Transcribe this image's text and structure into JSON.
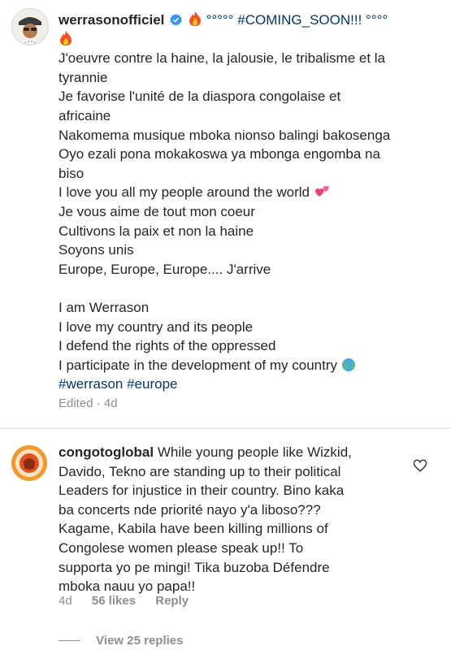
{
  "post": {
    "username": "werrasonofficiel",
    "head": "°°°°° #COMING_SOON!!! °°°°",
    "lines": [
      "J'oeuvre contre la haine, la jalousie, le tribalisme et la",
      "tyrannie",
      "Je favorise l'unité de la diaspora congolaise et",
      "africaine",
      "Nakomema musique mboka nionso balingi bakosenga",
      "Oyo ezali pona mokakoswa ya mbonga engomba na",
      "biso",
      "I love you all my people around the world",
      "Je vous aime de tout mon coeur",
      "Cultivons la paix et non la haine",
      "Soyons unis",
      "Europe, Europe, Europe.... J'arrive",
      "I am Werrason",
      "I love my country and its people",
      "I defend the rights of the oppressed",
      "I participate in the development of my country"
    ],
    "hashtags": "#werrason #europe",
    "edited": "Edited · 4d",
    "icons": [
      "verified-badge",
      "fire-emoji",
      "two-hearts-emoji",
      "globe-emoji"
    ]
  },
  "comment": {
    "username": "congotoglobal",
    "lines": [
      "While young people like Wizkid,",
      "Davido, Tekno are standing up to their political",
      "Leaders for injustice in their country. Bino kaka",
      "ba concerts nde priorité nayo y'a liboso???",
      "Kagame, Kabila have been killing millions of",
      "Congolese women please speak up!! To",
      "supporta yo pe mingi! Tika buzoba Défendre",
      "mboka nauu yo papa!!"
    ],
    "age": "4d",
    "likes": "56 likes",
    "reply": "Reply",
    "view_replies": "View 25 replies"
  },
  "colors": {
    "text": "#262626",
    "hashtag": "#00376b",
    "muted": "#8e8e8e",
    "verified": "#3897f0",
    "divider": "#dbdbdb"
  }
}
